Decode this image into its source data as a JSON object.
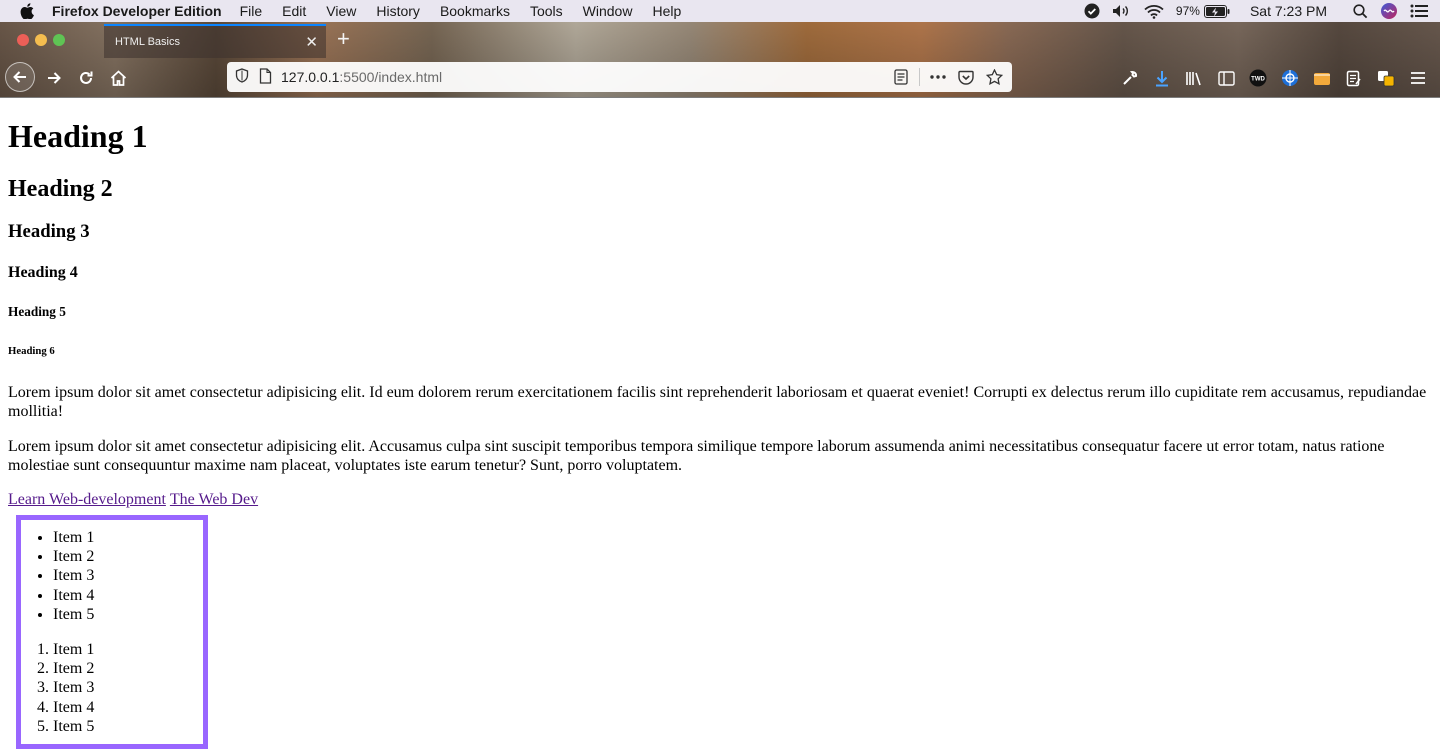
{
  "menubar": {
    "app_name": "Firefox Developer Edition",
    "items": [
      "File",
      "Edit",
      "View",
      "History",
      "Bookmarks",
      "Tools",
      "Window",
      "Help"
    ],
    "battery": "97%",
    "clock": "Sat 7:23 PM"
  },
  "browser": {
    "tab_title": "HTML Basics",
    "url_host": "127.0.0.1",
    "url_rest": ":5500/index.html",
    "accent_color": "#0a84ff"
  },
  "page": {
    "h1": "Heading 1",
    "h2": "Heading 2",
    "h3": "Heading 3",
    "h4": "Heading 4",
    "h5": "Heading 5",
    "h6": "Heading 6",
    "para1": "Lorem ipsum dolor sit amet consectetur adipisicing elit. Id eum dolorem rerum exercitationem facilis sint reprehenderit laboriosam et quaerat eveniet! Corrupti ex delectus rerum illo cupiditate rem accusamus, repudiandae mollitia!",
    "para2": "Lorem ipsum dolor sit amet consectetur adipisicing elit. Accusamus culpa sint suscipit temporibus tempora similique tempore laborum assumenda animi necessitatibus consequatur facere ut error totam, natus ratione molestiae sunt consequuntur maxime nam placeat, voluptates iste earum tenetur? Sunt, porro voluptatem.",
    "link1": "Learn Web-development",
    "link2": "The Web Dev",
    "unordered": [
      "Item 1",
      "Item 2",
      "Item 3",
      "Item 4",
      "Item 5"
    ],
    "ordered": [
      "Item 1",
      "Item 2",
      "Item 3",
      "Item 4",
      "Item 5"
    ],
    "highlight_color": "#9966ff"
  }
}
